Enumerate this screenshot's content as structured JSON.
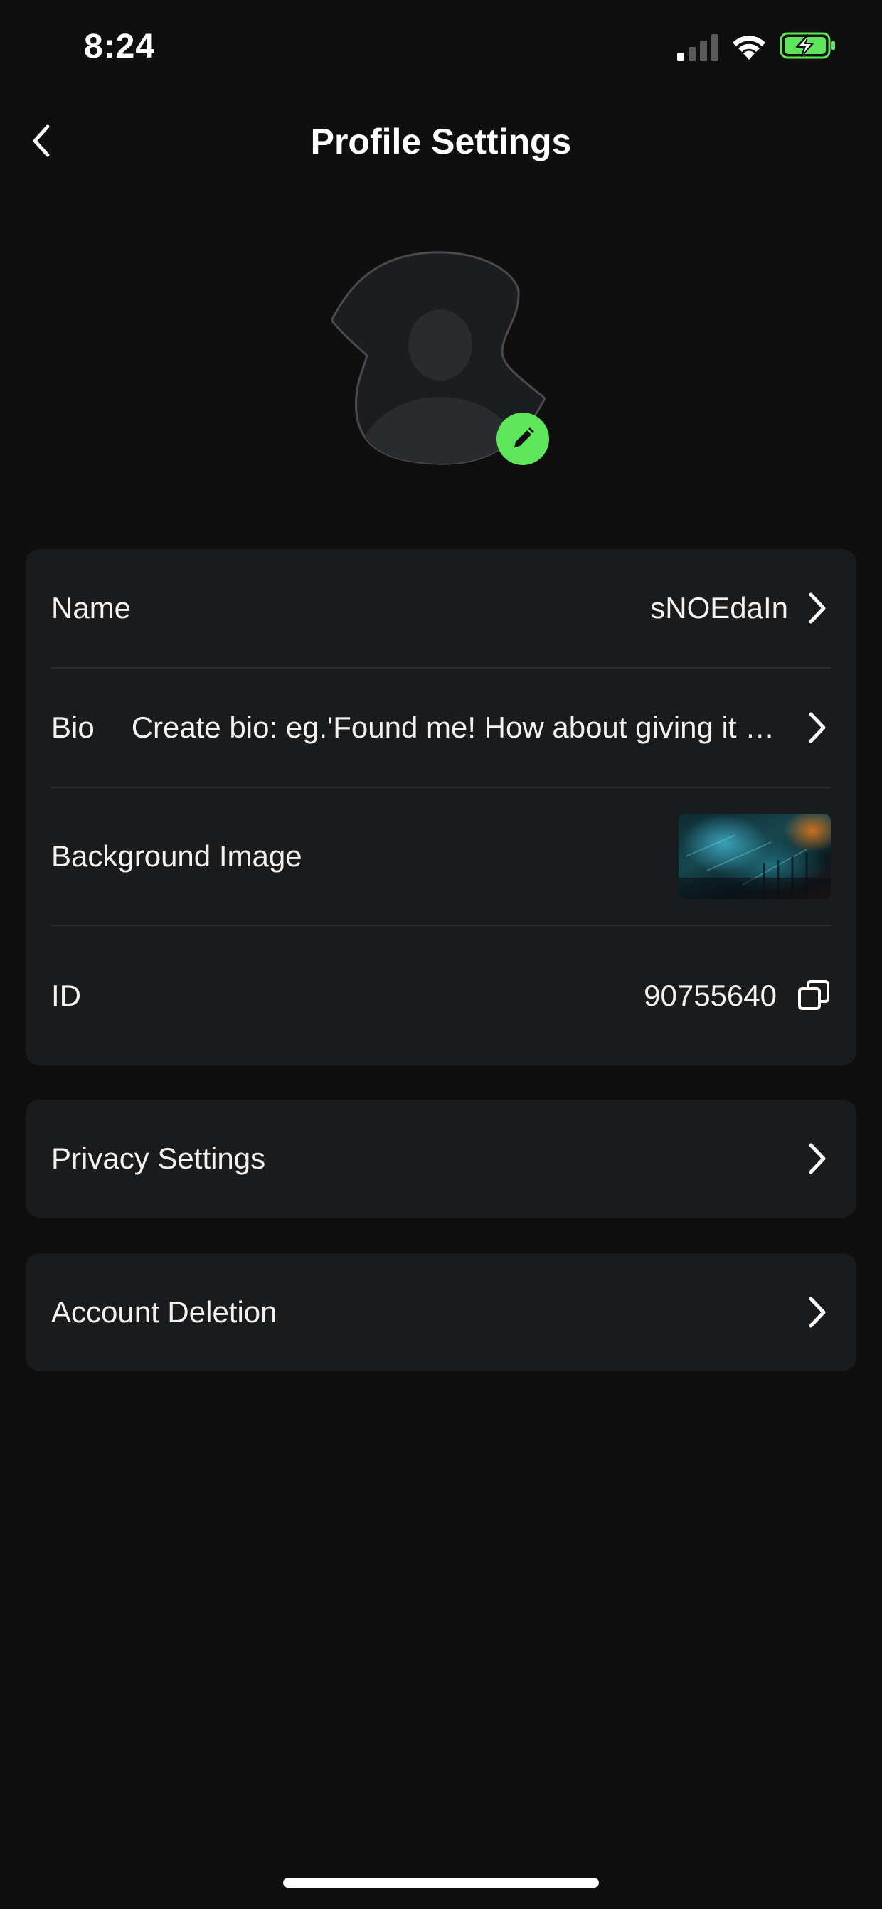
{
  "status_bar": {
    "time": "8:24",
    "icons": [
      "cellular-signal-icon",
      "wifi-icon",
      "battery-charging-icon"
    ],
    "battery_color": "#5ee65a"
  },
  "header": {
    "title": "Profile Settings",
    "back_icon": "chevron-left-icon"
  },
  "avatar": {
    "edit_icon": "pencil-icon",
    "badge_color": "#5ee65a"
  },
  "profile": {
    "name_label": "Name",
    "name_value": "sNOEdaIn",
    "bio_label": "Bio",
    "bio_value": "Create bio: eg.'Found me! How about giving it a like?'",
    "background_label": "Background Image",
    "id_label": "ID",
    "id_value": "90755640"
  },
  "menu": {
    "privacy_label": "Privacy Settings",
    "account_deletion_label": "Account Deletion"
  },
  "colors": {
    "background": "#0f0f10",
    "card": "#1a1b1d",
    "accent": "#5ee65a",
    "text": "#ffffff"
  }
}
